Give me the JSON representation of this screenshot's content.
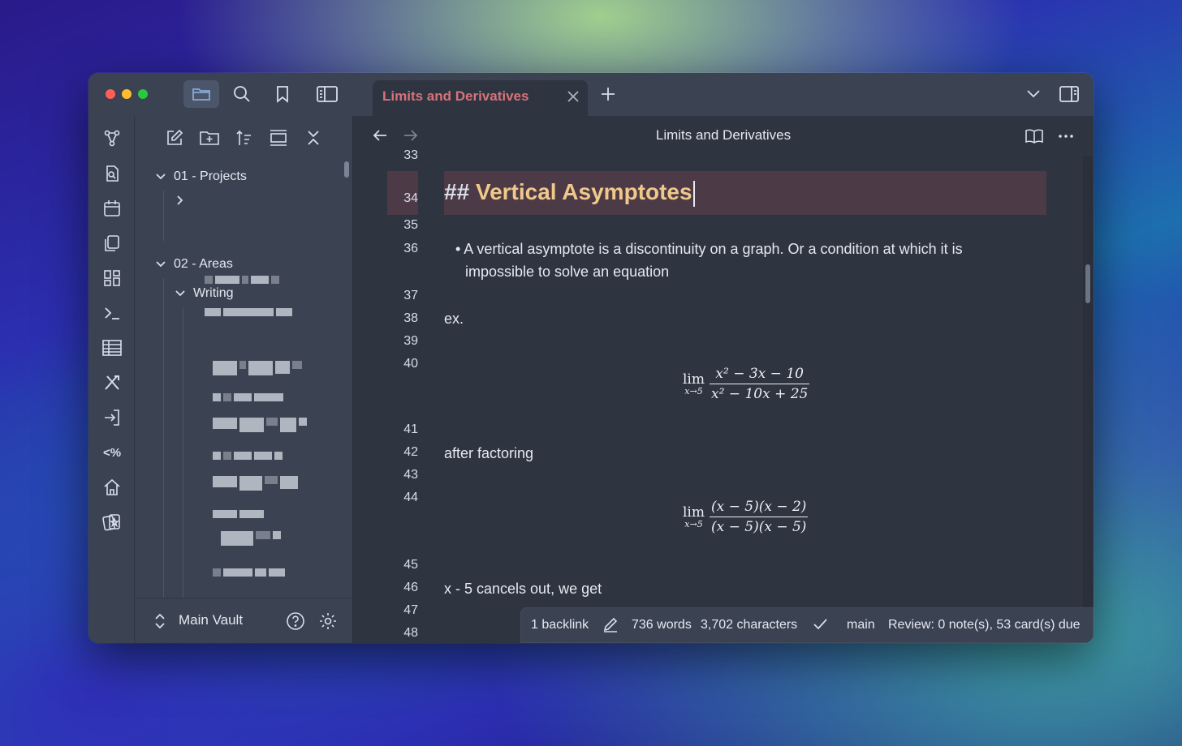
{
  "tab": {
    "title": "Limits and Derivatives"
  },
  "editor": {
    "title": "Limits and Derivatives",
    "line_numbers": [
      "33",
      "34",
      "35",
      "36",
      "37",
      "38",
      "39",
      "40",
      "41",
      "42",
      "43",
      "44",
      "45",
      "46",
      "47",
      "48"
    ],
    "heading_marker": "## ",
    "heading_text": "Vertical Asymptotes",
    "bullet": "• A vertical asymptote is a discontinuity on a graph. Or a condition at which it is",
    "bullet_cont": "impossible to solve an equation",
    "ex": "ex.",
    "after_factoring": "after factoring",
    "cancels": "x - 5 cancels out, we get",
    "math1": {
      "lim": "lim",
      "sub": "x→5",
      "num": "x² − 3x − 10",
      "den": "x² − 10x + 25"
    },
    "math2": {
      "lim": "lim",
      "sub": "x→5",
      "num": "(x − 5)(x − 2)",
      "den": "(x − 5)(x − 5)"
    }
  },
  "explorer": {
    "folder1": "01 - Projects",
    "folder2": "02 - Areas",
    "subfolder": "Writing",
    "vault": "Main Vault"
  },
  "status": {
    "backlinks": "1 backlink",
    "words": "736 words",
    "characters": "3,702 characters",
    "branch": "main",
    "review": "Review: 0 note(s), 53 card(s) due"
  },
  "ribbon": {
    "template_label": "<%"
  },
  "colors": {
    "accent": "#d9727a",
    "heading": "#f0c98a",
    "active_line": "#4d3a47"
  }
}
